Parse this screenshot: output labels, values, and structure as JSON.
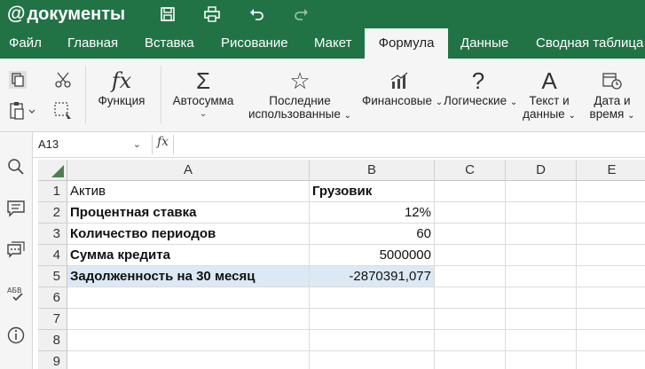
{
  "app": {
    "logo_symbol": "@",
    "logo_text": "документы"
  },
  "quick_access": [
    "save-icon",
    "print-icon",
    "undo-icon",
    "redo-icon"
  ],
  "tabs": [
    "Файл",
    "Главная",
    "Вставка",
    "Рисование",
    "Макет",
    "Формула",
    "Данные",
    "Сводная таблица"
  ],
  "active_tab": "Формула",
  "ribbon": {
    "function": "Функция",
    "autosum": "Автосумма",
    "recent_1": "Последние",
    "recent_2": "использованные",
    "financial": "Финансовые",
    "logical": "Логические",
    "text_1": "Текст и",
    "text_2": "данные",
    "date_1": "Дата и",
    "date_2": "время"
  },
  "formula_bar": {
    "name_box": "A13",
    "fx": "fx",
    "value": ""
  },
  "columns": [
    "A",
    "B",
    "C",
    "D",
    "E"
  ],
  "rows": [
    {
      "n": "1",
      "a": "Актив",
      "b": "Грузовик"
    },
    {
      "n": "2",
      "a": "Процентная ставка",
      "b": "12%"
    },
    {
      "n": "3",
      "a": "Количество периодов",
      "b": "60"
    },
    {
      "n": "4",
      "a": "Сумма кредита",
      "b": "5000000"
    },
    {
      "n": "5",
      "a": "Задолженность на 30 месяц",
      "b": "-2870391,077"
    },
    {
      "n": "6",
      "a": "",
      "b": ""
    },
    {
      "n": "7",
      "a": "",
      "b": ""
    },
    {
      "n": "8",
      "a": "",
      "b": ""
    },
    {
      "n": "9",
      "a": "",
      "b": ""
    }
  ],
  "colors": {
    "brand": "#217346",
    "highlight": "#dce9f4"
  }
}
